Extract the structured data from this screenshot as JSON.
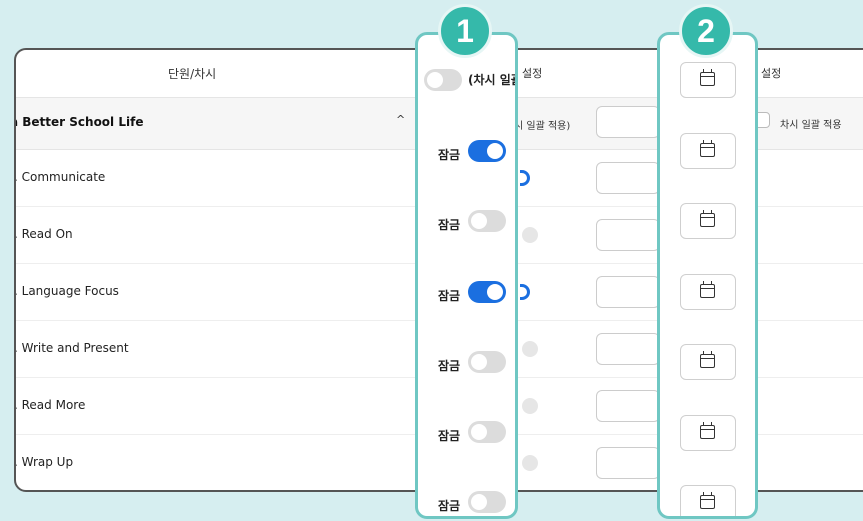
{
  "table": {
    "col_header": "단원/차시",
    "col_setting_1": "설정",
    "col_setting_2": "설정",
    "unit": {
      "title": "a Better School Life",
      "chevron": "^",
      "apply_all_1": "시 일괄 적용)",
      "apply_all_2": "차시 일괄 적용"
    },
    "lessons": [
      {
        "name": ". Communicate",
        "locked": true
      },
      {
        "name": ". Read On",
        "locked": false
      },
      {
        "name": ". Language Focus",
        "locked": true
      },
      {
        "name": ". Write and Present",
        "locked": false
      },
      {
        "name": ". Read More",
        "locked": false
      },
      {
        "name": ". Wrap Up",
        "locked": false
      }
    ]
  },
  "callouts": {
    "badge_1": "1",
    "badge_2": "2",
    "header_toggle_label": "(차시 일괄",
    "lock_label": "잠금",
    "lock_rows": [
      {
        "label": "잠금",
        "on": true
      },
      {
        "label": "잠금",
        "on": false
      },
      {
        "label": "잠금",
        "on": true
      },
      {
        "label": "잠금",
        "on": false
      },
      {
        "label": "잠금",
        "on": false
      },
      {
        "label": "잠금",
        "on": false
      }
    ]
  },
  "icons": {
    "date": "calendar-icon",
    "expand": "chevron-up-icon"
  },
  "colors": {
    "accent": "#1b6fe0",
    "highlight": "#6fc7c3",
    "badge": "#35b9aa",
    "background": "#d6eef0"
  }
}
